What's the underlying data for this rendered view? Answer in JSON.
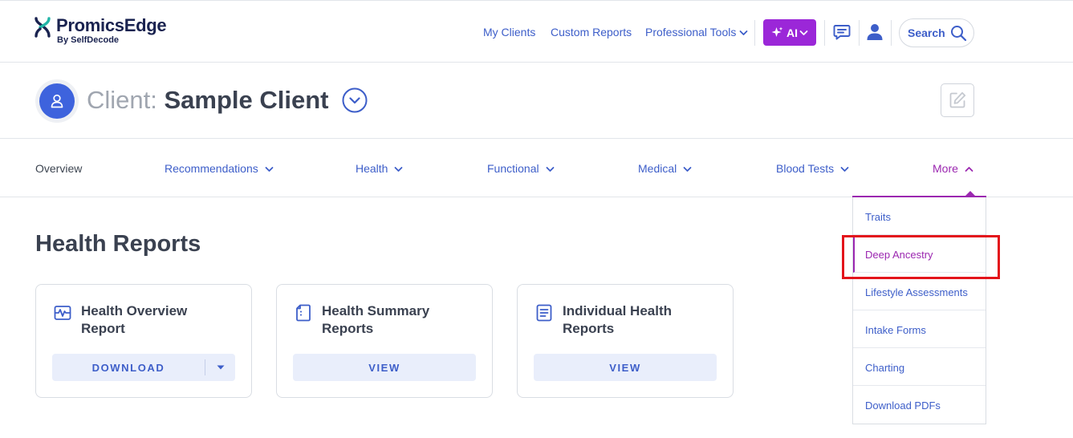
{
  "brand": {
    "name": "PromicsEdge",
    "sub": "By SelfDecode"
  },
  "header": {
    "nav": [
      "My Clients",
      "Custom Reports",
      "Professional Tools"
    ],
    "ai_label": "AI",
    "search_label": "Search",
    "icons": {
      "ai": "sparkle-icon",
      "chat": "chat-icon",
      "user": "user-icon",
      "search": "search-icon"
    }
  },
  "client": {
    "prefix": "Client:",
    "name": "Sample Client"
  },
  "tabs": [
    {
      "label": "Overview"
    },
    {
      "label": "Recommendations"
    },
    {
      "label": "Health"
    },
    {
      "label": "Functional"
    },
    {
      "label": "Medical"
    },
    {
      "label": "Blood Tests"
    },
    {
      "label": "More"
    }
  ],
  "section": {
    "title": "Health Reports"
  },
  "cards": [
    {
      "title": "Health Overview Report",
      "button": "DOWNLOAD",
      "icon": "pulse-icon"
    },
    {
      "title": "Health Summary Reports",
      "button": "VIEW",
      "icon": "document-icon"
    },
    {
      "title": "Individual Health Reports",
      "button": "VIEW",
      "icon": "list-document-icon"
    }
  ],
  "more_menu": {
    "items": [
      "Traits",
      "Deep Ancestry",
      "Lifestyle Assessments",
      "Intake Forms",
      "Charting",
      "Download PDFs"
    ],
    "active": "Deep Ancestry"
  },
  "colors": {
    "primary": "#3d5ec9",
    "accent": "#9b27b0",
    "ai_button": "#9b27d8",
    "avatar": "#3e63dd",
    "highlight": "#e3141b",
    "heading": "#3a4150"
  }
}
